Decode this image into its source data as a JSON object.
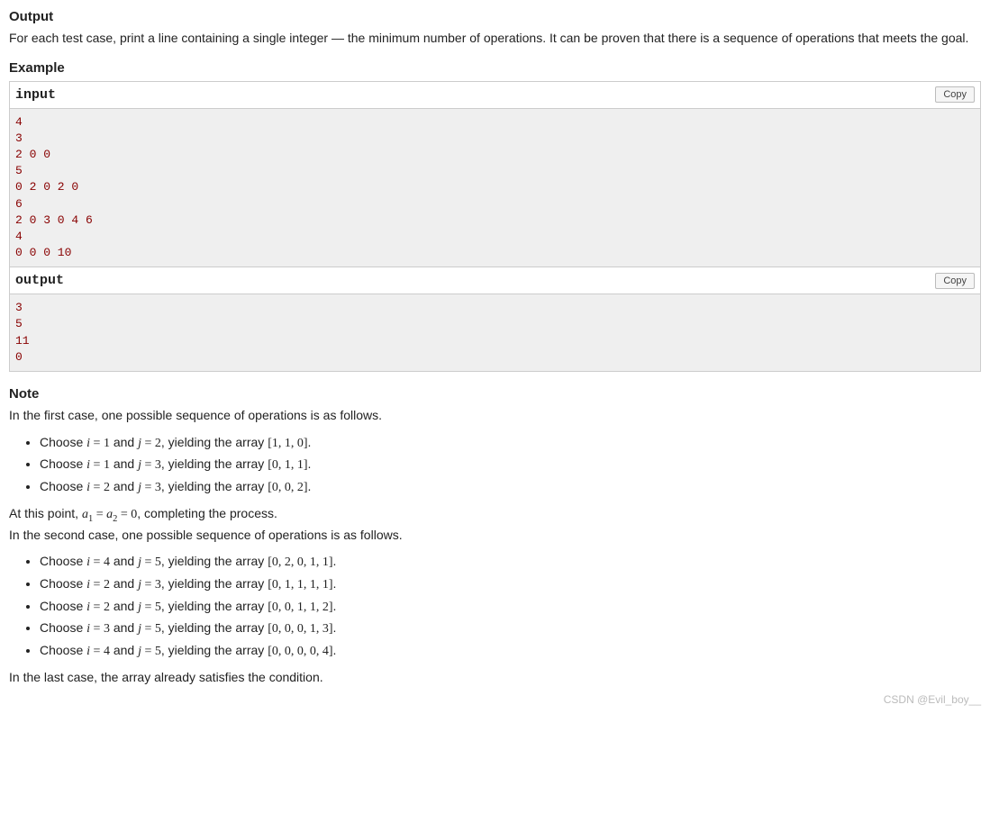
{
  "output": {
    "title": "Output",
    "desc": "For each test case, print a line containing a single integer — the minimum number of operations. It can be proven that there is a sequence of operations that meets the goal."
  },
  "example": {
    "title": "Example",
    "input_label": "input",
    "output_label": "output",
    "copy_label": "Copy",
    "input_data": "4\n3\n2 0 0\n5\n0 2 0 2 0\n6\n2 0 3 0 4 6\n4\n0 0 0 10",
    "output_data": "3\n5\n11\n0"
  },
  "note": {
    "title": "Note",
    "intro1": "In the first case, one possible sequence of operations is as follows.",
    "case1": [
      {
        "i": "1",
        "j": "2",
        "array": "[1, 1, 0]"
      },
      {
        "i": "1",
        "j": "3",
        "array": "[0, 1, 1]"
      },
      {
        "i": "2",
        "j": "3",
        "array": "[0, 0, 2]"
      }
    ],
    "after1_prefix": "At this point, ",
    "after1_mid": ", completing the process.",
    "intro2": "In the second case, one possible sequence of operations is as follows.",
    "case2": [
      {
        "i": "4",
        "j": "5",
        "array": "[0, 2, 0, 1, 1]"
      },
      {
        "i": "2",
        "j": "3",
        "array": "[0, 1, 1, 1, 1]"
      },
      {
        "i": "2",
        "j": "5",
        "array": "[0, 0, 1, 1, 2]"
      },
      {
        "i": "3",
        "j": "5",
        "array": "[0, 0, 0, 1, 3]"
      },
      {
        "i": "4",
        "j": "5",
        "array": "[0, 0, 0, 0, 4]"
      }
    ],
    "last": "In the last case, the array already satisfies the condition."
  },
  "watermark": "CSDN @Evil_boy__",
  "labels": {
    "choose": "Choose ",
    "and": " and ",
    "yielding": ", yielding the array ",
    "period": "."
  }
}
